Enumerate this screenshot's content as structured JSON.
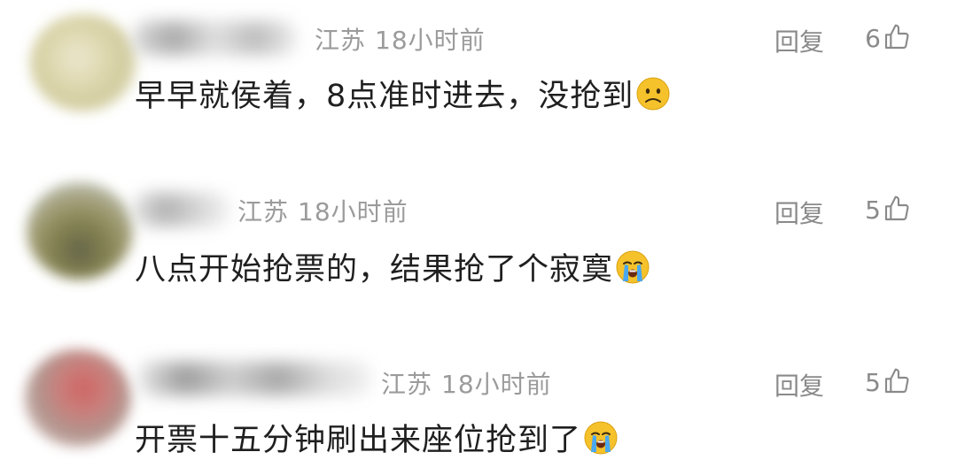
{
  "comments": [
    {
      "location": "江苏",
      "time": "18小时前",
      "text": "早早就侯着，8点准时进去，没抢到",
      "emoji": "frowning-face-icon",
      "reply_label": "回复",
      "likes": "6"
    },
    {
      "location": "江苏",
      "time": "18小时前",
      "text": "八点开始抢票的，结果抢了个寂寞",
      "emoji": "loudly-crying-face-icon",
      "reply_label": "回复",
      "likes": "5"
    },
    {
      "location": "江苏",
      "time": "18小时前",
      "text": "开票十五分钟刷出来座位抢到了",
      "emoji": "loudly-crying-face-icon",
      "reply_label": "回复",
      "likes": "5"
    }
  ],
  "colors": {
    "text": "#1f1f1f",
    "meta": "#9b9b9b",
    "action": "#8a8a8a",
    "emoji_yellow": "#f6c22b"
  }
}
